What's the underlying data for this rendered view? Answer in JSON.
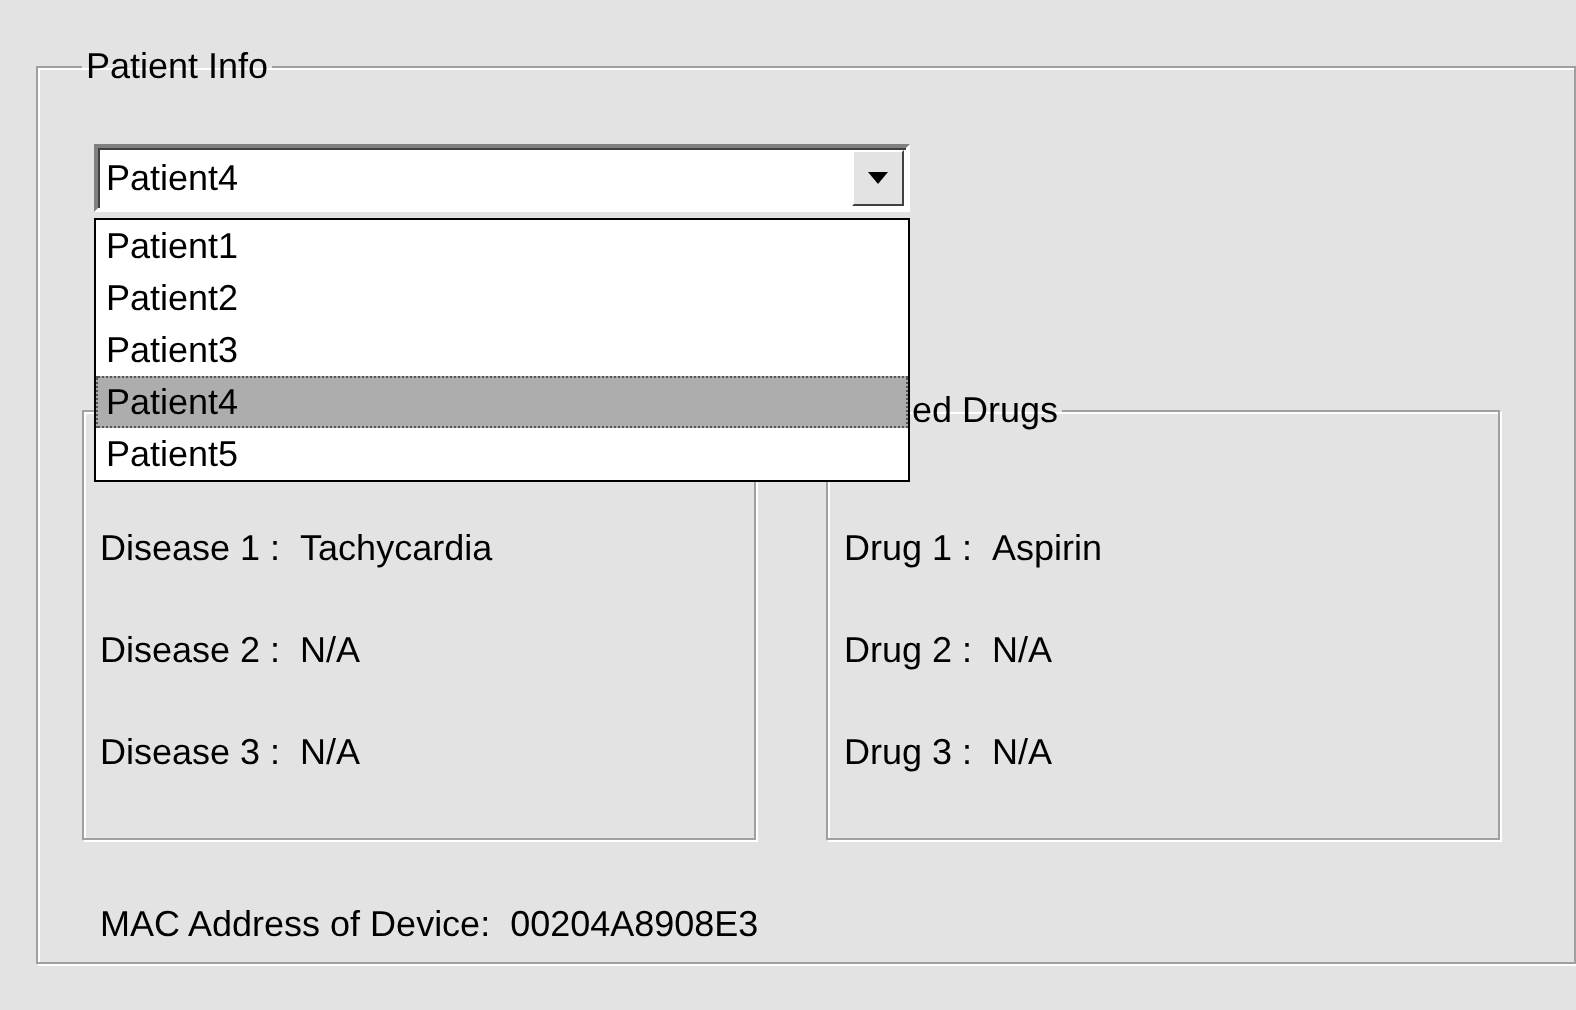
{
  "group": {
    "title": "Patient Info"
  },
  "patient_select": {
    "value": "Patient4",
    "expanded": true,
    "options": [
      {
        "label": "Patient1",
        "selected": false
      },
      {
        "label": "Patient2",
        "selected": false
      },
      {
        "label": "Patient3",
        "selected": false
      },
      {
        "label": "Patient4",
        "selected": true
      },
      {
        "label": "Patient5",
        "selected": false
      }
    ]
  },
  "diseases_group": {
    "rows": [
      {
        "label": "Disease 1 :",
        "value": "Tachycardia"
      },
      {
        "label": "Disease 2 :",
        "value": "N/A"
      },
      {
        "label": "Disease 3 :",
        "value": "N/A"
      }
    ]
  },
  "drugs_group": {
    "title": "ed Drugs",
    "rows": [
      {
        "label": "Drug 1 :",
        "value": "Aspirin"
      },
      {
        "label": "Drug 2 :",
        "value": "N/A"
      },
      {
        "label": "Drug 3 :",
        "value": "N/A"
      }
    ]
  },
  "mac": {
    "label": "MAC Address of Device:",
    "value": "00204A8908E3"
  }
}
